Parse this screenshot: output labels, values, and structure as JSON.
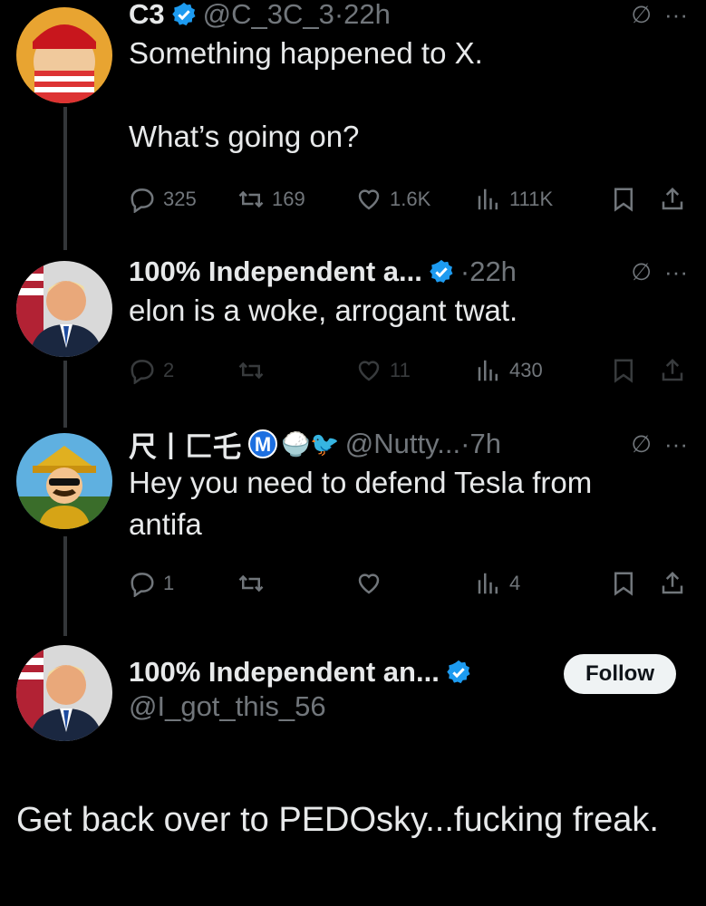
{
  "tweets": [
    {
      "name": "C3",
      "handle": "@C_3C_3",
      "time": "·22h",
      "text": "Something happened to X.\n\nWhat’s going on?",
      "replies": "325",
      "reposts": "169",
      "likes": "1.6K",
      "views": "111K"
    },
    {
      "name": "100% Independent a...",
      "time": "·22h",
      "text": "elon is a woke, arrogant twat.",
      "replies": "2",
      "reposts": "",
      "likes": "11",
      "views": "430"
    },
    {
      "name": "尺丨匚乇",
      "badge": "M",
      "emoji": "🍚🐦",
      "handle": "@Nutty...",
      "time": "·7h",
      "text": "Hey you need to defend Tesla from\nantifa",
      "replies": "1",
      "reposts": "",
      "likes": "",
      "views": "4"
    }
  ],
  "main_tweet": {
    "name": "100% Independent an...",
    "handle": "@I_got_this_56",
    "follow_label": "Follow",
    "text": "Get back over to PEDOsky...fucking freak."
  },
  "icons": {
    "verified_color": "#1d9bf0",
    "grok": "∅",
    "more": "···"
  }
}
